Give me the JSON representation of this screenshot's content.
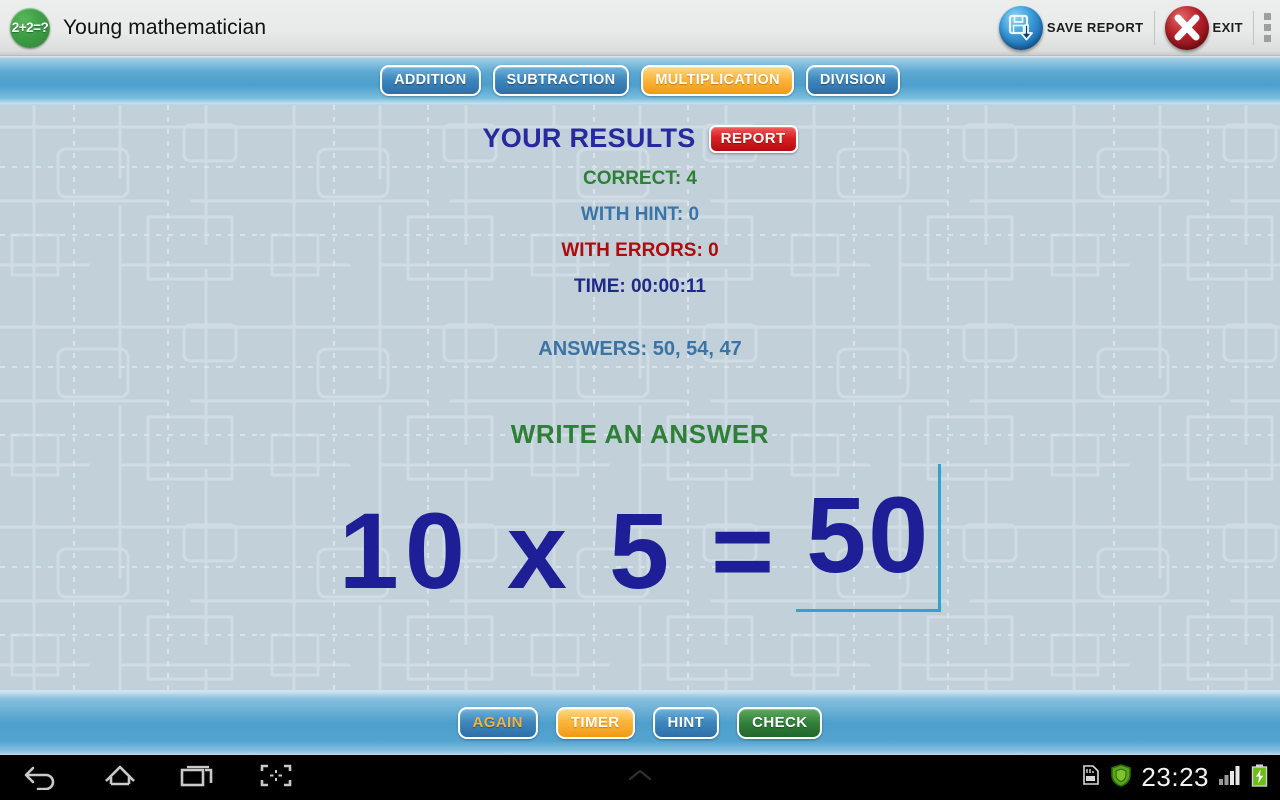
{
  "titlebar": {
    "logo_text": "2+2=?",
    "app_title": "Young mathematician",
    "save_report_label": "SAVE REPORT",
    "save_report_icon": "save-disk-orb-icon",
    "exit_label": "EXIT",
    "exit_icon": "exit-x-orb-icon",
    "overflow_icon": "overflow-menu-icon"
  },
  "tabs": [
    {
      "label": "ADDITION",
      "active": false
    },
    {
      "label": "SUBTRACTION",
      "active": false
    },
    {
      "label": "MULTIPLICATION",
      "active": true
    },
    {
      "label": "DIVISION",
      "active": false
    }
  ],
  "results": {
    "title": "YOUR RESULTS",
    "report_label": "REPORT",
    "correct": "CORRECT: 4",
    "with_hint": "WITH HINT: 0",
    "with_errors": "WITH ERRORS: 0",
    "time": "TIME: 00:00:11",
    "answers": "ANSWERS: 50, 54, 47"
  },
  "task": {
    "prompt": "WRITE AN ANSWER",
    "expression": "10 x 5 =",
    "answer_value": "50"
  },
  "bottom_buttons": [
    {
      "label": "AGAIN",
      "style": "again"
    },
    {
      "label": "TIMER",
      "style": "timer"
    },
    {
      "label": "HINT",
      "style": "hint"
    },
    {
      "label": "CHECK",
      "style": "check"
    }
  ],
  "navbar": {
    "back_icon": "back-arrow-icon",
    "home_icon": "home-icon",
    "recents_icon": "recent-apps-icon",
    "screenshot_icon": "screenshot-crop-icon",
    "drawer_icon": "chevron-up-icon",
    "sdcard_icon": "sd-card-icon",
    "shield_icon": "antivirus-shield-icon",
    "clock": "23:23",
    "signal_icon": "signal-bars-icon",
    "battery_icon": "battery-charging-icon"
  },
  "colors": {
    "accent_blue": "#4e9fcd",
    "active_tab": "#fcb63c",
    "correct_green": "#2e8038",
    "error_red": "#b00b0b",
    "navy": "#1e1e96",
    "board_bg": "#c2d0da"
  }
}
